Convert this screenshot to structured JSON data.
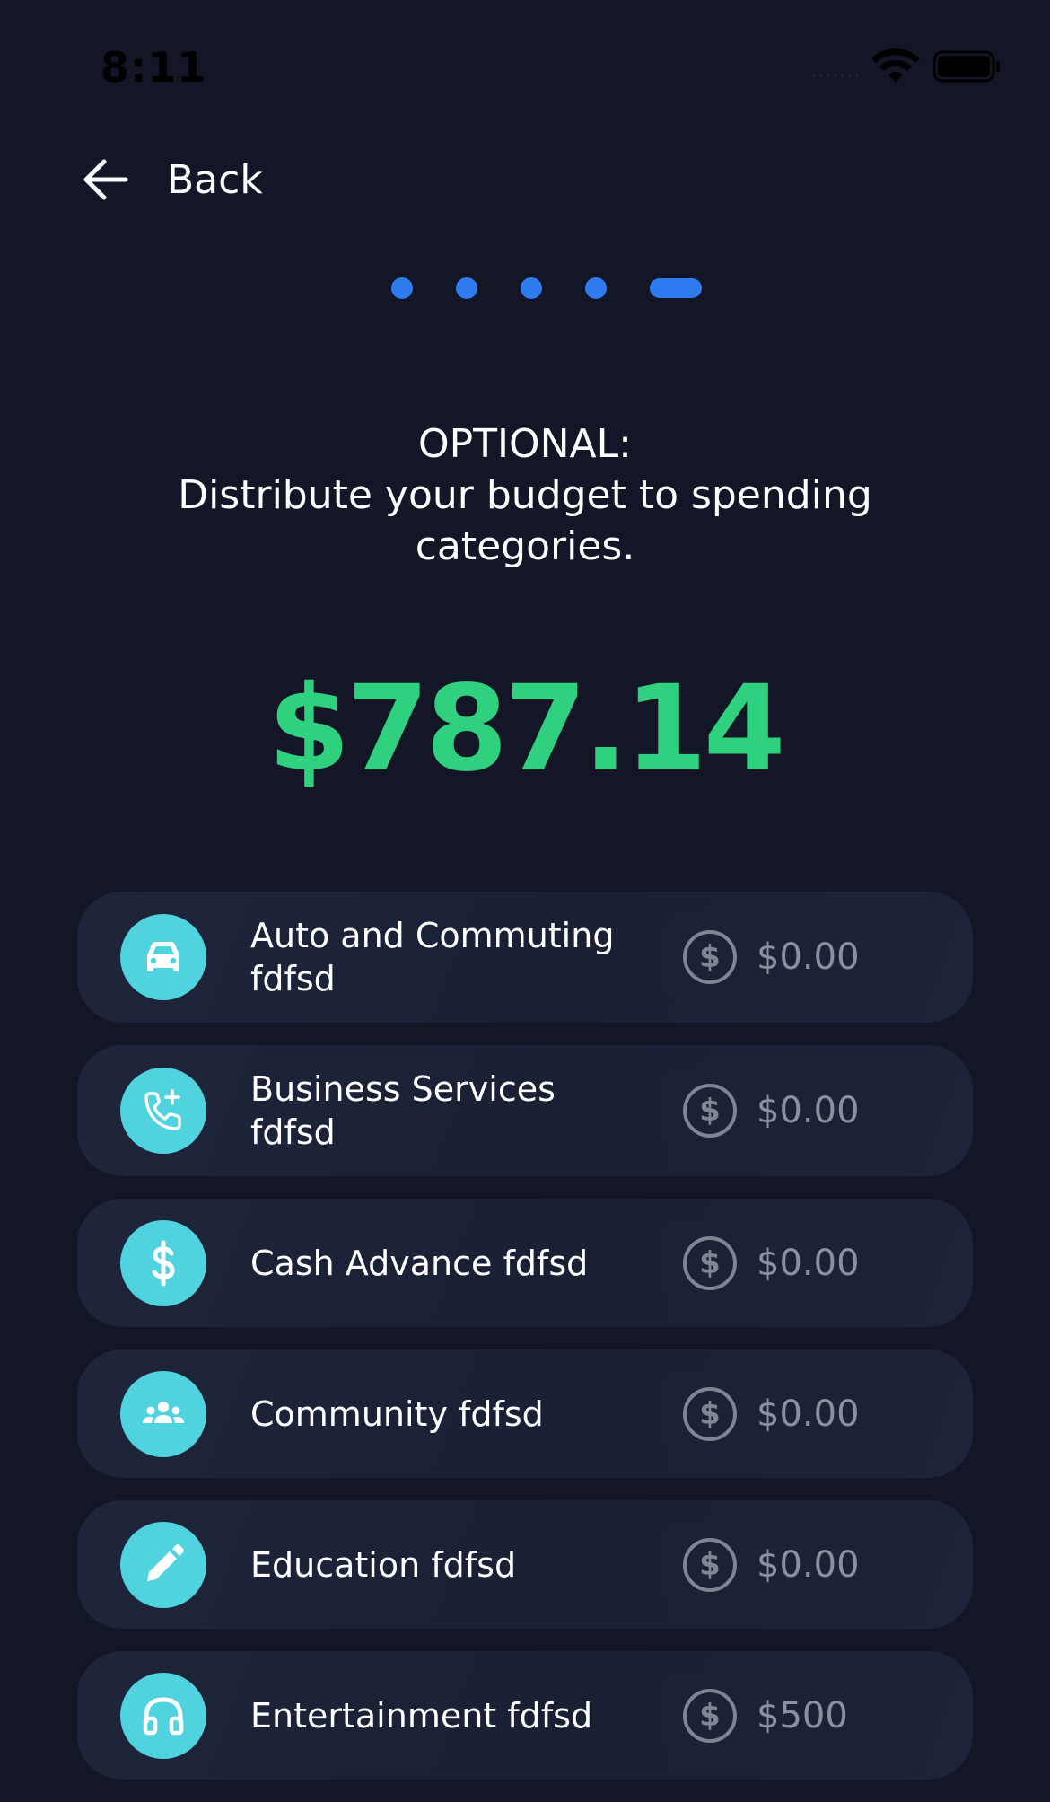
{
  "status_bar": {
    "time": "8:11",
    "icons": [
      "signal-icon",
      "wifi-icon",
      "battery-icon"
    ]
  },
  "nav": {
    "back_label": "Back",
    "back_icon": "arrow-left-icon"
  },
  "pager": {
    "total_steps": 5,
    "current_step": 5
  },
  "heading": {
    "line1": "OPTIONAL:",
    "line2": "Distribute your budget to spending",
    "line3": "categories."
  },
  "total_amount": "$787.14",
  "colors": {
    "background": "#121626",
    "accent_blue": "#2e7cf0",
    "amount_green": "#2fd17f",
    "icon_teal": "#4fd3df"
  },
  "categories": [
    {
      "label_line1": "Auto and Commuting",
      "label_line2": "fdfsd",
      "icon": "car-icon",
      "currency_symbol": "$",
      "placeholder": "$0.00",
      "value": ""
    },
    {
      "label_line1": "Business Services",
      "label_line2": "fdfsd",
      "icon": "phone-add-icon",
      "currency_symbol": "$",
      "placeholder": "$0.00",
      "value": ""
    },
    {
      "label_line1": "Cash Advance fdfsd",
      "label_line2": "",
      "icon": "dollar-icon",
      "currency_symbol": "$",
      "placeholder": "$0.00",
      "value": ""
    },
    {
      "label_line1": "Community fdfsd",
      "label_line2": "",
      "icon": "people-icon",
      "currency_symbol": "$",
      "placeholder": "$0.00",
      "value": ""
    },
    {
      "label_line1": "Education fdfsd",
      "label_line2": "",
      "icon": "pencil-icon",
      "currency_symbol": "$",
      "placeholder": "$0.00",
      "value": ""
    },
    {
      "label_line1": "Entertainment fdfsd",
      "label_line2": "",
      "icon": "headphones-icon",
      "currency_symbol": "$",
      "placeholder": "",
      "value": "$500"
    }
  ]
}
